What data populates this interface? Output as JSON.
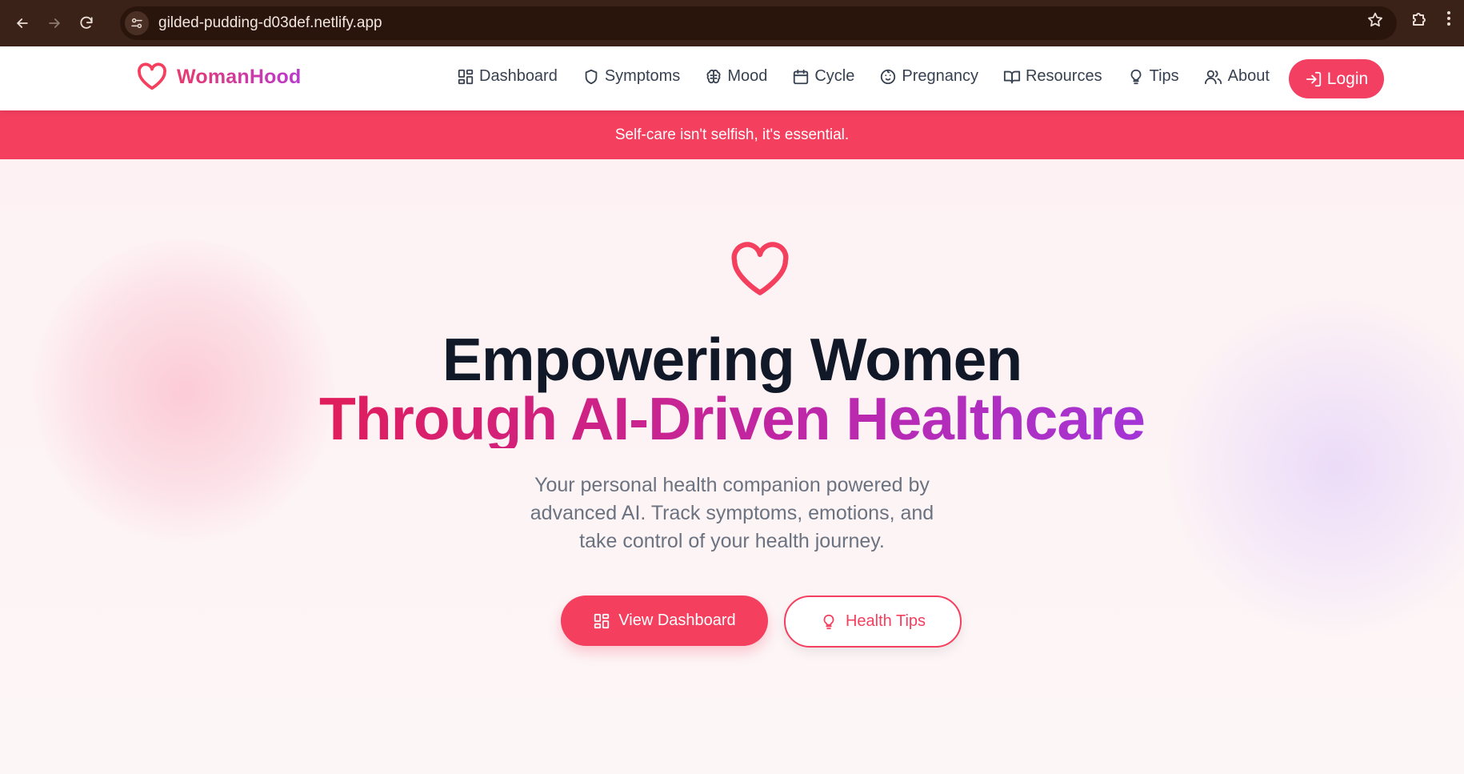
{
  "browser": {
    "url": "gilded-pudding-d03def.netlify.app",
    "icons": [
      "back-arrow",
      "forward-arrow",
      "reload",
      "site-settings",
      "star",
      "extensions",
      "menu"
    ]
  },
  "site": {
    "logo_text": "WomanHood",
    "nav": [
      {
        "label": "Dashboard",
        "icon": "grid-icon"
      },
      {
        "label": "Symptoms",
        "icon": "shield-icon"
      },
      {
        "label": "Mood",
        "icon": "brain-icon"
      },
      {
        "label": "Cycle",
        "icon": "calendar-icon"
      },
      {
        "label": "Pregnancy",
        "icon": "baby-icon"
      },
      {
        "label": "Resources",
        "icon": "book-icon"
      },
      {
        "label": "Tips",
        "icon": "lightbulb-icon"
      },
      {
        "label": "About",
        "icon": "users-icon"
      }
    ],
    "login_label": "Login"
  },
  "banner": {
    "text": "Self-care isn't selfish, it's essential."
  },
  "hero": {
    "headline_line1": "Empowering Women",
    "headline_line2": "Through AI-Driven Healthcare",
    "subtitle": "Your personal health companion powered by advanced AI. Track symptoms, emotions, and take control of your health journey.",
    "primary_button": "View Dashboard",
    "secondary_button": "Health Tips"
  },
  "colors": {
    "accent": "#f43f5e",
    "brand_gradient_start": "#e11d5b",
    "brand_gradient_end": "#a435d6",
    "heading": "#111827",
    "body_text": "#6b7280",
    "chrome_bg": "#3b2218"
  }
}
